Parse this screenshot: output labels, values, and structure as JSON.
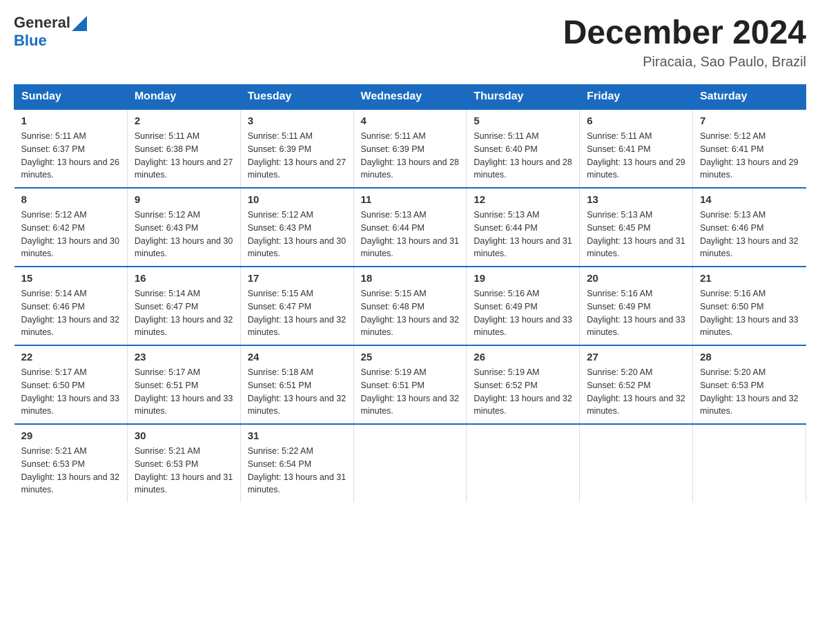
{
  "logo": {
    "general": "General",
    "blue": "Blue"
  },
  "title": "December 2024",
  "subtitle": "Piracaia, Sao Paulo, Brazil",
  "headers": [
    "Sunday",
    "Monday",
    "Tuesday",
    "Wednesday",
    "Thursday",
    "Friday",
    "Saturday"
  ],
  "weeks": [
    [
      {
        "day": "1",
        "sunrise": "5:11 AM",
        "sunset": "6:37 PM",
        "daylight": "13 hours and 26 minutes."
      },
      {
        "day": "2",
        "sunrise": "5:11 AM",
        "sunset": "6:38 PM",
        "daylight": "13 hours and 27 minutes."
      },
      {
        "day": "3",
        "sunrise": "5:11 AM",
        "sunset": "6:39 PM",
        "daylight": "13 hours and 27 minutes."
      },
      {
        "day": "4",
        "sunrise": "5:11 AM",
        "sunset": "6:39 PM",
        "daylight": "13 hours and 28 minutes."
      },
      {
        "day": "5",
        "sunrise": "5:11 AM",
        "sunset": "6:40 PM",
        "daylight": "13 hours and 28 minutes."
      },
      {
        "day": "6",
        "sunrise": "5:11 AM",
        "sunset": "6:41 PM",
        "daylight": "13 hours and 29 minutes."
      },
      {
        "day": "7",
        "sunrise": "5:12 AM",
        "sunset": "6:41 PM",
        "daylight": "13 hours and 29 minutes."
      }
    ],
    [
      {
        "day": "8",
        "sunrise": "5:12 AM",
        "sunset": "6:42 PM",
        "daylight": "13 hours and 30 minutes."
      },
      {
        "day": "9",
        "sunrise": "5:12 AM",
        "sunset": "6:43 PM",
        "daylight": "13 hours and 30 minutes."
      },
      {
        "day": "10",
        "sunrise": "5:12 AM",
        "sunset": "6:43 PM",
        "daylight": "13 hours and 30 minutes."
      },
      {
        "day": "11",
        "sunrise": "5:13 AM",
        "sunset": "6:44 PM",
        "daylight": "13 hours and 31 minutes."
      },
      {
        "day": "12",
        "sunrise": "5:13 AM",
        "sunset": "6:44 PM",
        "daylight": "13 hours and 31 minutes."
      },
      {
        "day": "13",
        "sunrise": "5:13 AM",
        "sunset": "6:45 PM",
        "daylight": "13 hours and 31 minutes."
      },
      {
        "day": "14",
        "sunrise": "5:13 AM",
        "sunset": "6:46 PM",
        "daylight": "13 hours and 32 minutes."
      }
    ],
    [
      {
        "day": "15",
        "sunrise": "5:14 AM",
        "sunset": "6:46 PM",
        "daylight": "13 hours and 32 minutes."
      },
      {
        "day": "16",
        "sunrise": "5:14 AM",
        "sunset": "6:47 PM",
        "daylight": "13 hours and 32 minutes."
      },
      {
        "day": "17",
        "sunrise": "5:15 AM",
        "sunset": "6:47 PM",
        "daylight": "13 hours and 32 minutes."
      },
      {
        "day": "18",
        "sunrise": "5:15 AM",
        "sunset": "6:48 PM",
        "daylight": "13 hours and 32 minutes."
      },
      {
        "day": "19",
        "sunrise": "5:16 AM",
        "sunset": "6:49 PM",
        "daylight": "13 hours and 33 minutes."
      },
      {
        "day": "20",
        "sunrise": "5:16 AM",
        "sunset": "6:49 PM",
        "daylight": "13 hours and 33 minutes."
      },
      {
        "day": "21",
        "sunrise": "5:16 AM",
        "sunset": "6:50 PM",
        "daylight": "13 hours and 33 minutes."
      }
    ],
    [
      {
        "day": "22",
        "sunrise": "5:17 AM",
        "sunset": "6:50 PM",
        "daylight": "13 hours and 33 minutes."
      },
      {
        "day": "23",
        "sunrise": "5:17 AM",
        "sunset": "6:51 PM",
        "daylight": "13 hours and 33 minutes."
      },
      {
        "day": "24",
        "sunrise": "5:18 AM",
        "sunset": "6:51 PM",
        "daylight": "13 hours and 32 minutes."
      },
      {
        "day": "25",
        "sunrise": "5:19 AM",
        "sunset": "6:51 PM",
        "daylight": "13 hours and 32 minutes."
      },
      {
        "day": "26",
        "sunrise": "5:19 AM",
        "sunset": "6:52 PM",
        "daylight": "13 hours and 32 minutes."
      },
      {
        "day": "27",
        "sunrise": "5:20 AM",
        "sunset": "6:52 PM",
        "daylight": "13 hours and 32 minutes."
      },
      {
        "day": "28",
        "sunrise": "5:20 AM",
        "sunset": "6:53 PM",
        "daylight": "13 hours and 32 minutes."
      }
    ],
    [
      {
        "day": "29",
        "sunrise": "5:21 AM",
        "sunset": "6:53 PM",
        "daylight": "13 hours and 32 minutes."
      },
      {
        "day": "30",
        "sunrise": "5:21 AM",
        "sunset": "6:53 PM",
        "daylight": "13 hours and 31 minutes."
      },
      {
        "day": "31",
        "sunrise": "5:22 AM",
        "sunset": "6:54 PM",
        "daylight": "13 hours and 31 minutes."
      },
      null,
      null,
      null,
      null
    ]
  ]
}
